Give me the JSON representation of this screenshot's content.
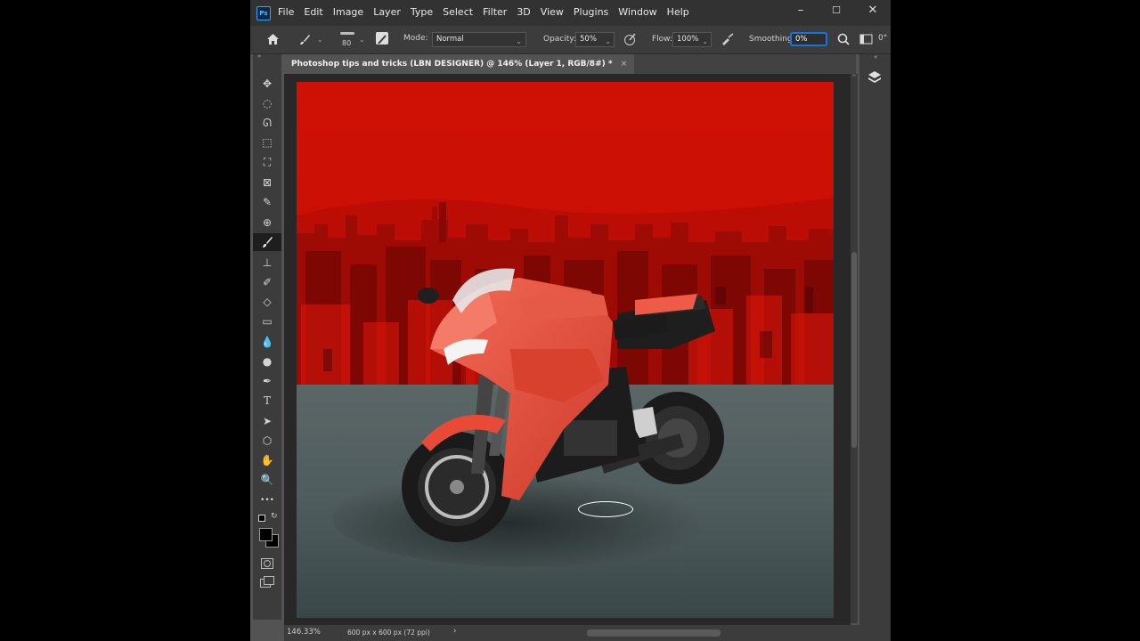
{
  "app": {
    "logo": "Ps",
    "menu": [
      "File",
      "Edit",
      "Image",
      "Layer",
      "Type",
      "Select",
      "Filter",
      "3D",
      "View",
      "Plugins",
      "Window",
      "Help"
    ],
    "window_controls": {
      "minimize": "–",
      "maximize": "☐",
      "close": "✕"
    }
  },
  "options": {
    "brush_size": "80",
    "mode_label": "Mode:",
    "mode_value": "Normal",
    "opacity_label": "Opacity:",
    "opacity_value": "50%",
    "flow_label": "Flow:",
    "flow_value": "100%",
    "smoothing_label": "Smoothing:",
    "smoothing_value": "0%",
    "angle_value": "0°"
  },
  "document": {
    "tab_title": "Photoshop tips and tricks (LBN DESIGNER) @ 146% (Layer 1, RGB/8#) *",
    "close_glyph": "×"
  },
  "status": {
    "zoom": "146.33%",
    "doc_size": "600 px x 600 px (72 ppi)",
    "arrow": "›"
  },
  "tools": [
    "move-tool",
    "marquee-tool",
    "lasso-tool",
    "object-select-tool",
    "crop-tool",
    "frame-tool",
    "eyedropper-tool",
    "healing-tool",
    "brush-tool",
    "stamp-tool",
    "history-brush-tool",
    "eraser-tool",
    "gradient-tool",
    "blur-tool",
    "dodge-tool",
    "pen-tool",
    "type-tool",
    "path-select-tool",
    "shape-tool",
    "hand-tool",
    "zoom-tool",
    "more-tools"
  ],
  "tool_glyphs": [
    "✥",
    "◌",
    "ᘏ",
    "⬚",
    "⛶",
    "⊠",
    "✎",
    "⊕",
    "🖌",
    "⊥",
    "✐",
    "◇",
    "▭",
    "💧",
    "●",
    "✒",
    "T",
    "➤",
    "⬡",
    "✋",
    "🔍",
    "•••"
  ],
  "colors": {
    "accent": "#1473e6",
    "sky_red": "#d41208",
    "bike_red": "#e8503c"
  }
}
